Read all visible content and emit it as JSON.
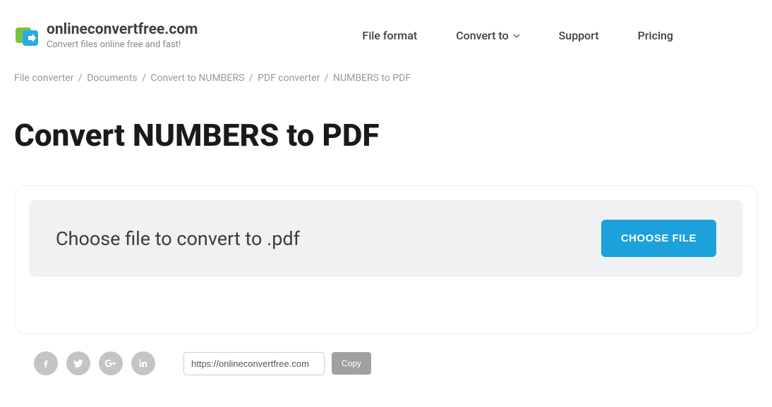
{
  "header": {
    "site_name": "onlineconvertfree.com",
    "tagline": "Convert files online free and fast!"
  },
  "nav": {
    "file_format": "File format",
    "convert_to": "Convert to",
    "support": "Support",
    "pricing": "Pricing"
  },
  "breadcrumb": {
    "items": [
      "File converter",
      "Documents",
      "Convert to NUMBERS",
      "PDF converter",
      "NUMBERS to PDF"
    ]
  },
  "page_title": "Convert NUMBERS to PDF",
  "upload": {
    "prompt": "Choose file to convert to .pdf",
    "button": "CHOOSE FILE"
  },
  "share": {
    "url": "https://onlineconvertfree.com",
    "copy": "Copy"
  }
}
